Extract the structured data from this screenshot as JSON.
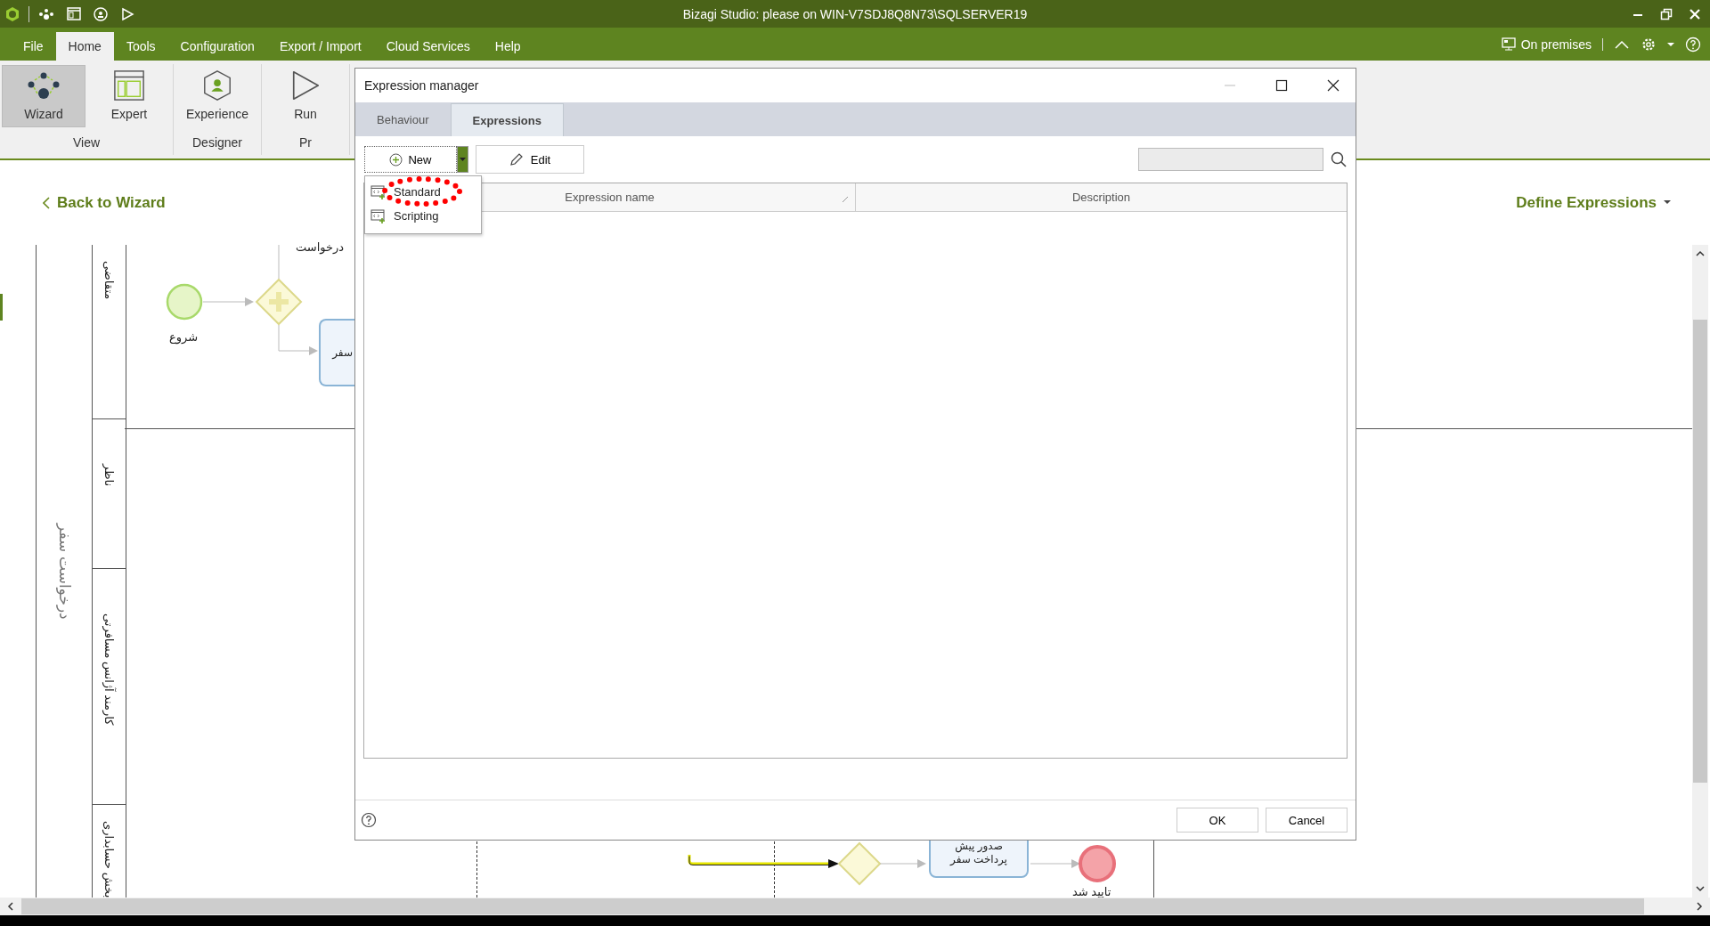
{
  "window": {
    "title": "Bizagi Studio: please  on WIN-V7SDJ8Q8N73\\SQLSERVER19"
  },
  "menu_tabs": [
    {
      "label": "File",
      "selected": false
    },
    {
      "label": "Home",
      "selected": true
    },
    {
      "label": "Tools",
      "selected": false
    },
    {
      "label": "Configuration",
      "selected": false
    },
    {
      "label": "Export / Import",
      "selected": false
    },
    {
      "label": "Cloud Services",
      "selected": false
    },
    {
      "label": "Help",
      "selected": false
    }
  ],
  "environment": {
    "label": "On premises"
  },
  "ribbon": {
    "groups": [
      {
        "label": "View",
        "buttons": [
          {
            "kind": "wizard",
            "label": "Wizard",
            "selected": true
          },
          {
            "kind": "expert",
            "label": "Expert",
            "selected": false
          }
        ]
      },
      {
        "label": "Designer",
        "buttons": [
          {
            "kind": "experience",
            "label": "Experience",
            "selected": false
          }
        ]
      },
      {
        "label": "Pr",
        "buttons": [
          {
            "kind": "run",
            "label": "Run",
            "selected": false
          }
        ]
      }
    ]
  },
  "header": {
    "back_link": "Back to Wizard",
    "step_menu": "Define Expressions"
  },
  "diagram": {
    "pool": "درخواست سفر",
    "lanes": [
      "متقاضی",
      "ناظر",
      "کارمند آژانس مسافرتی",
      "بخش حسابداری"
    ],
    "labels": {
      "start": "شروع",
      "flow_top": "درخواست",
      "task_top": [
        "سفر"
      ],
      "task_bottom": [
        "صدور پیش",
        "پرداخت سفر"
      ],
      "end": "تایید شد"
    }
  },
  "dialog": {
    "title": "Expression manager",
    "tabs": [
      {
        "label": "Behaviour",
        "selected": false
      },
      {
        "label": "Expressions",
        "selected": true
      }
    ],
    "new_button": "New",
    "edit_button": "Edit",
    "new_menu": {
      "expanded": true,
      "items": [
        {
          "label": "Standard",
          "highlighted": true
        },
        {
          "label": "Scripting",
          "highlighted": false
        }
      ]
    },
    "columns": [
      "Expression name",
      "Description"
    ],
    "buttons": [
      "OK",
      "Cancel"
    ]
  }
}
